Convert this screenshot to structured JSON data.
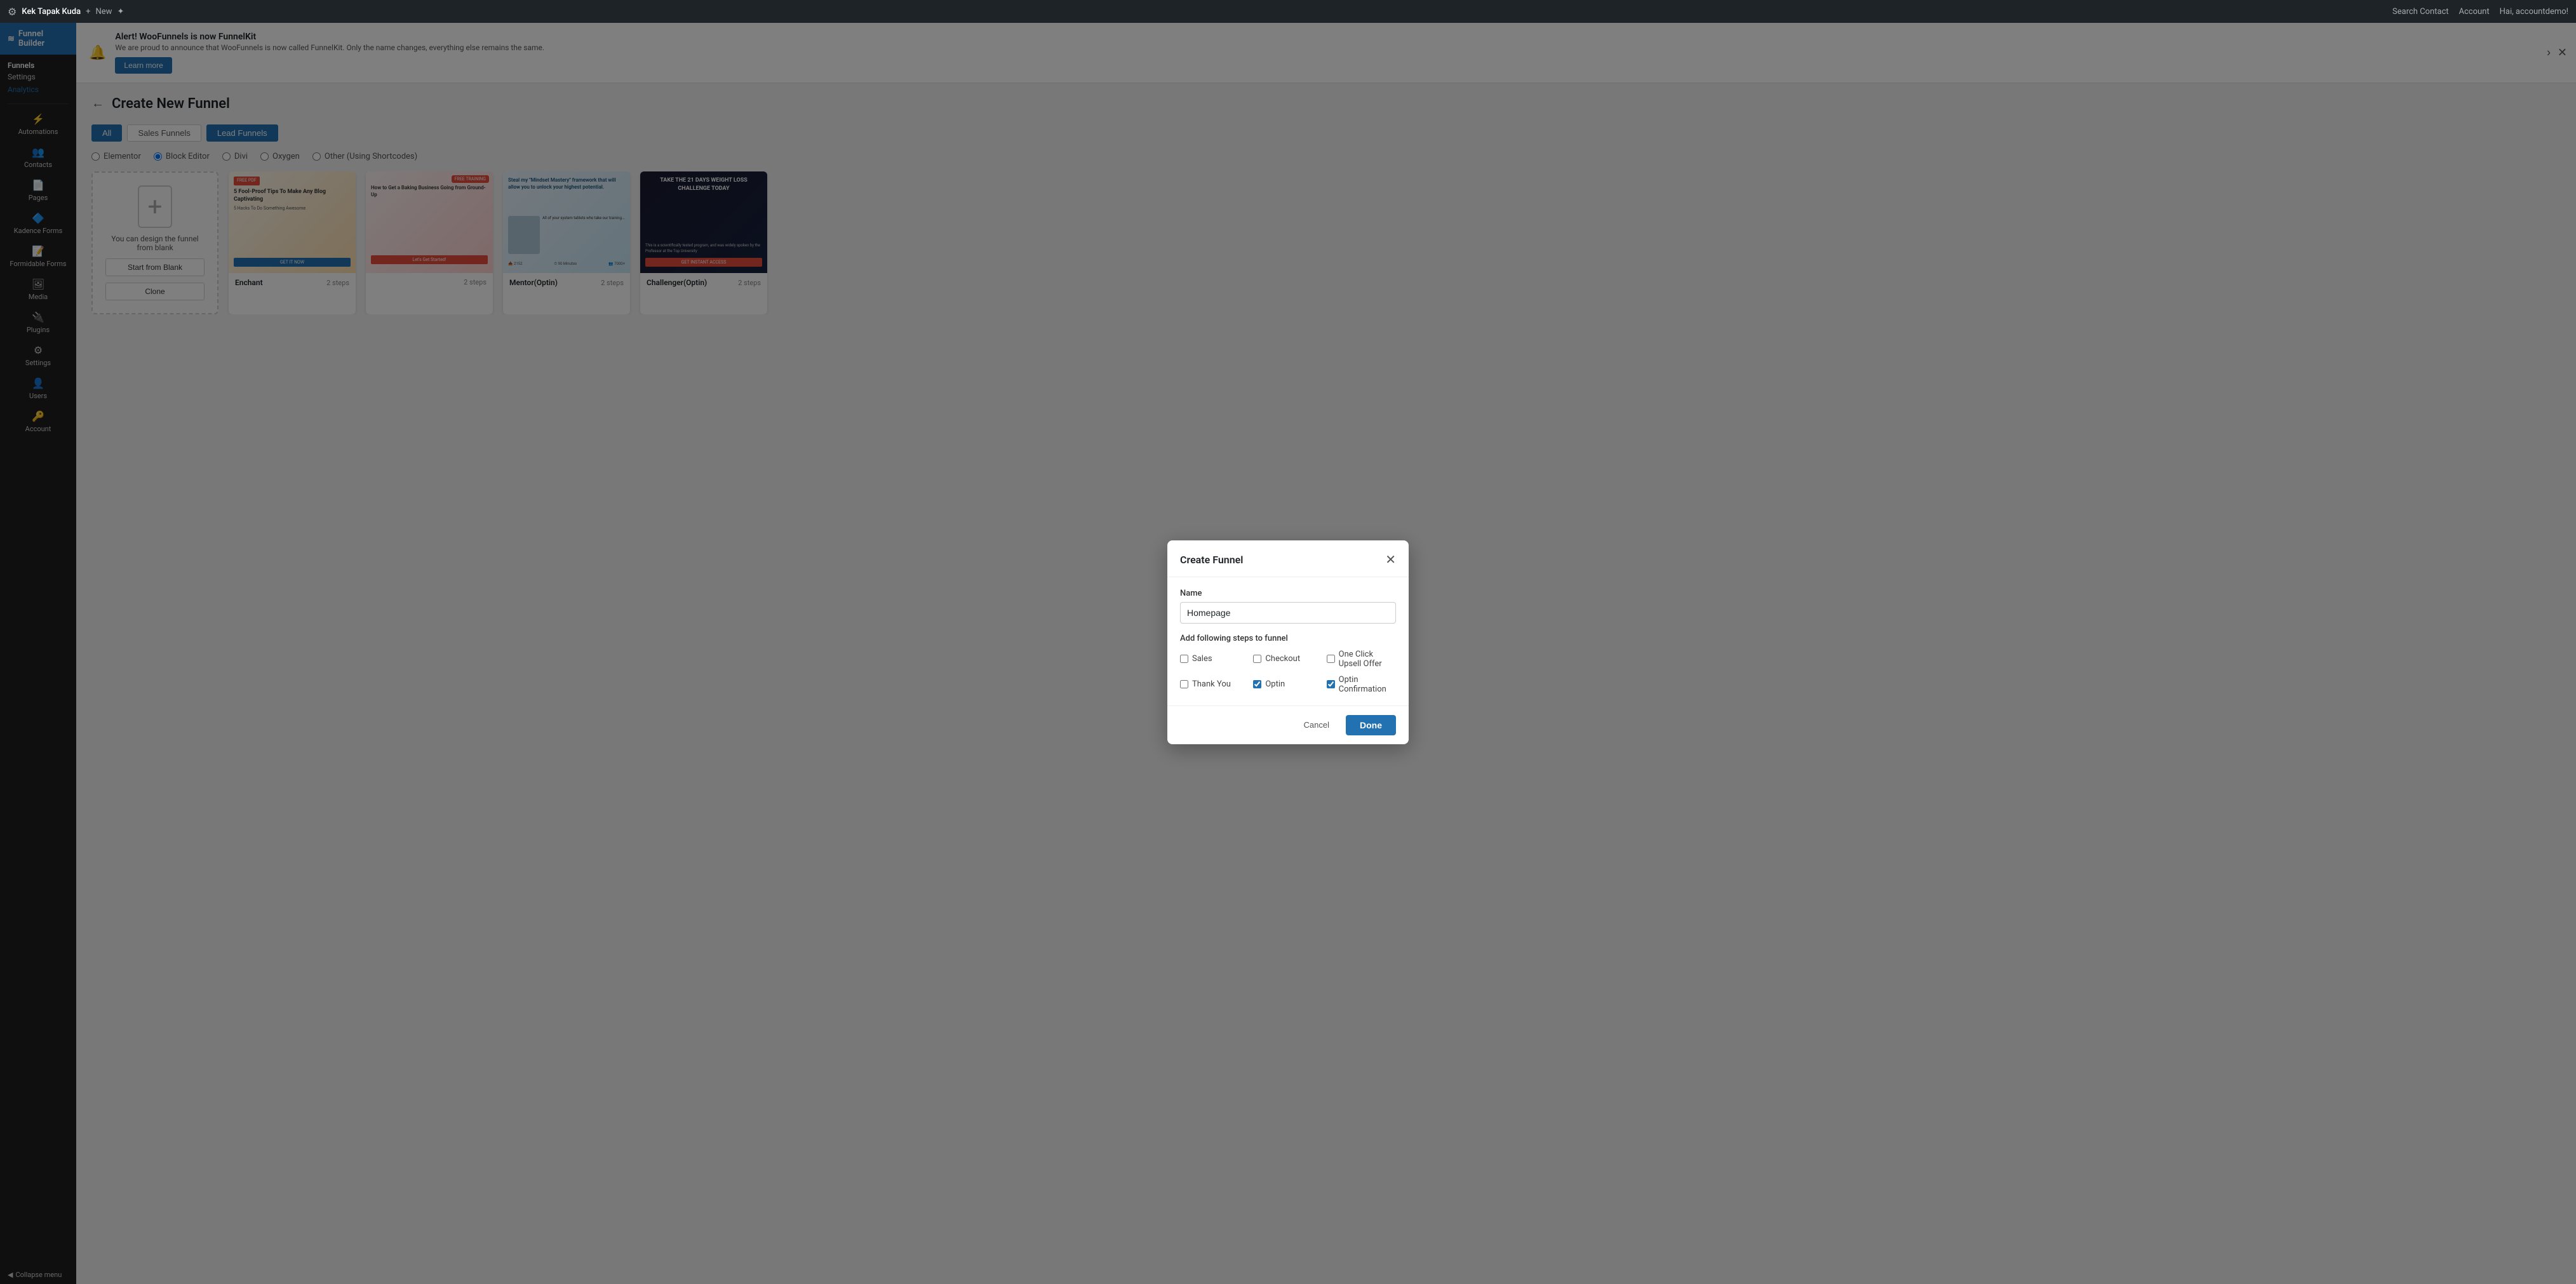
{
  "topbar": {
    "site_name": "Kek Tapak Kuda",
    "new_label": "New",
    "search_label": "Search Contact",
    "account_label": "Account",
    "greeting": "Hai, accountdemo!"
  },
  "sidebar": {
    "header_label": "Funnel Builder",
    "funnels_label": "Funnels",
    "settings_label": "Settings",
    "analytics_label": "Analytics",
    "automations_label": "Automations",
    "contacts_label": "Contacts",
    "pages_label": "Pages",
    "kadence_label": "Kadence Forms",
    "formidable_label": "Formidable Forms",
    "media_label": "Media",
    "plugins_label": "Plugins",
    "settings2_label": "Settings",
    "users_label": "Users",
    "account_label": "Account",
    "collapse_label": "Collapse menu"
  },
  "alert": {
    "title": "Alert! WooFunnels is now FunnelKit",
    "description": "We are proud to announce that WooFunnels is now called FunnelKit. Only the name changes, everything else remains the same.",
    "learn_more": "Learn more"
  },
  "page": {
    "back_label": "←",
    "title": "Create New Funnel"
  },
  "filter_tabs": [
    {
      "label": "All",
      "active": true
    },
    {
      "label": "Sales Funnels",
      "active": false
    },
    {
      "label": "Lead Funnels",
      "active": false
    }
  ],
  "builder_options": [
    {
      "label": "Elementor",
      "value": "elementor",
      "checked": false
    },
    {
      "label": "Block Editor",
      "value": "block-editor",
      "checked": true
    },
    {
      "label": "Divi",
      "value": "divi",
      "checked": false
    },
    {
      "label": "Oxygen",
      "value": "oxygen",
      "checked": false
    },
    {
      "label": "Other (Using Shortcodes)",
      "value": "shortcodes",
      "checked": false
    }
  ],
  "blank_card": {
    "text": "You can design the funnel from blank",
    "start_label": "Start from Blank",
    "clone_label": "Clone"
  },
  "templates": [
    {
      "name": "Enchant",
      "steps": "2 steps",
      "style": "tpl-enchant",
      "badge": "",
      "content": "5 Fool-Proof Tips To Make Any Blog Captivating"
    },
    {
      "name": "",
      "steps": "2 steps",
      "style": "tpl-generic1",
      "badge": "FREE TRAINING",
      "content": "How to Get a Baking Business Going from Ground-Up"
    },
    {
      "name": "Mentor(Optin)",
      "steps": "2 steps",
      "style": "tpl-mentor",
      "badge": "",
      "content": "Steal my Mindset Mastery framework"
    },
    {
      "name": "Challenger(Optin)",
      "steps": "2 steps",
      "style": "tpl-challenger",
      "badge": "",
      "content": "TAKE THE 21 DAYS WEIGHT LOSS CHALLENGE TODAY"
    }
  ],
  "modal": {
    "title": "Create Funnel",
    "name_label": "Name",
    "name_value": "Homepage",
    "steps_label": "Add following steps to funnel",
    "checkboxes": [
      {
        "label": "Sales",
        "checked": false
      },
      {
        "label": "Checkout",
        "checked": false
      },
      {
        "label": "One Click Upsell Offer",
        "checked": false
      },
      {
        "label": "Thank You",
        "checked": false
      },
      {
        "label": "Optin",
        "checked": true
      },
      {
        "label": "Optin Confirmation",
        "checked": true
      }
    ],
    "cancel_label": "Cancel",
    "done_label": "Done"
  }
}
